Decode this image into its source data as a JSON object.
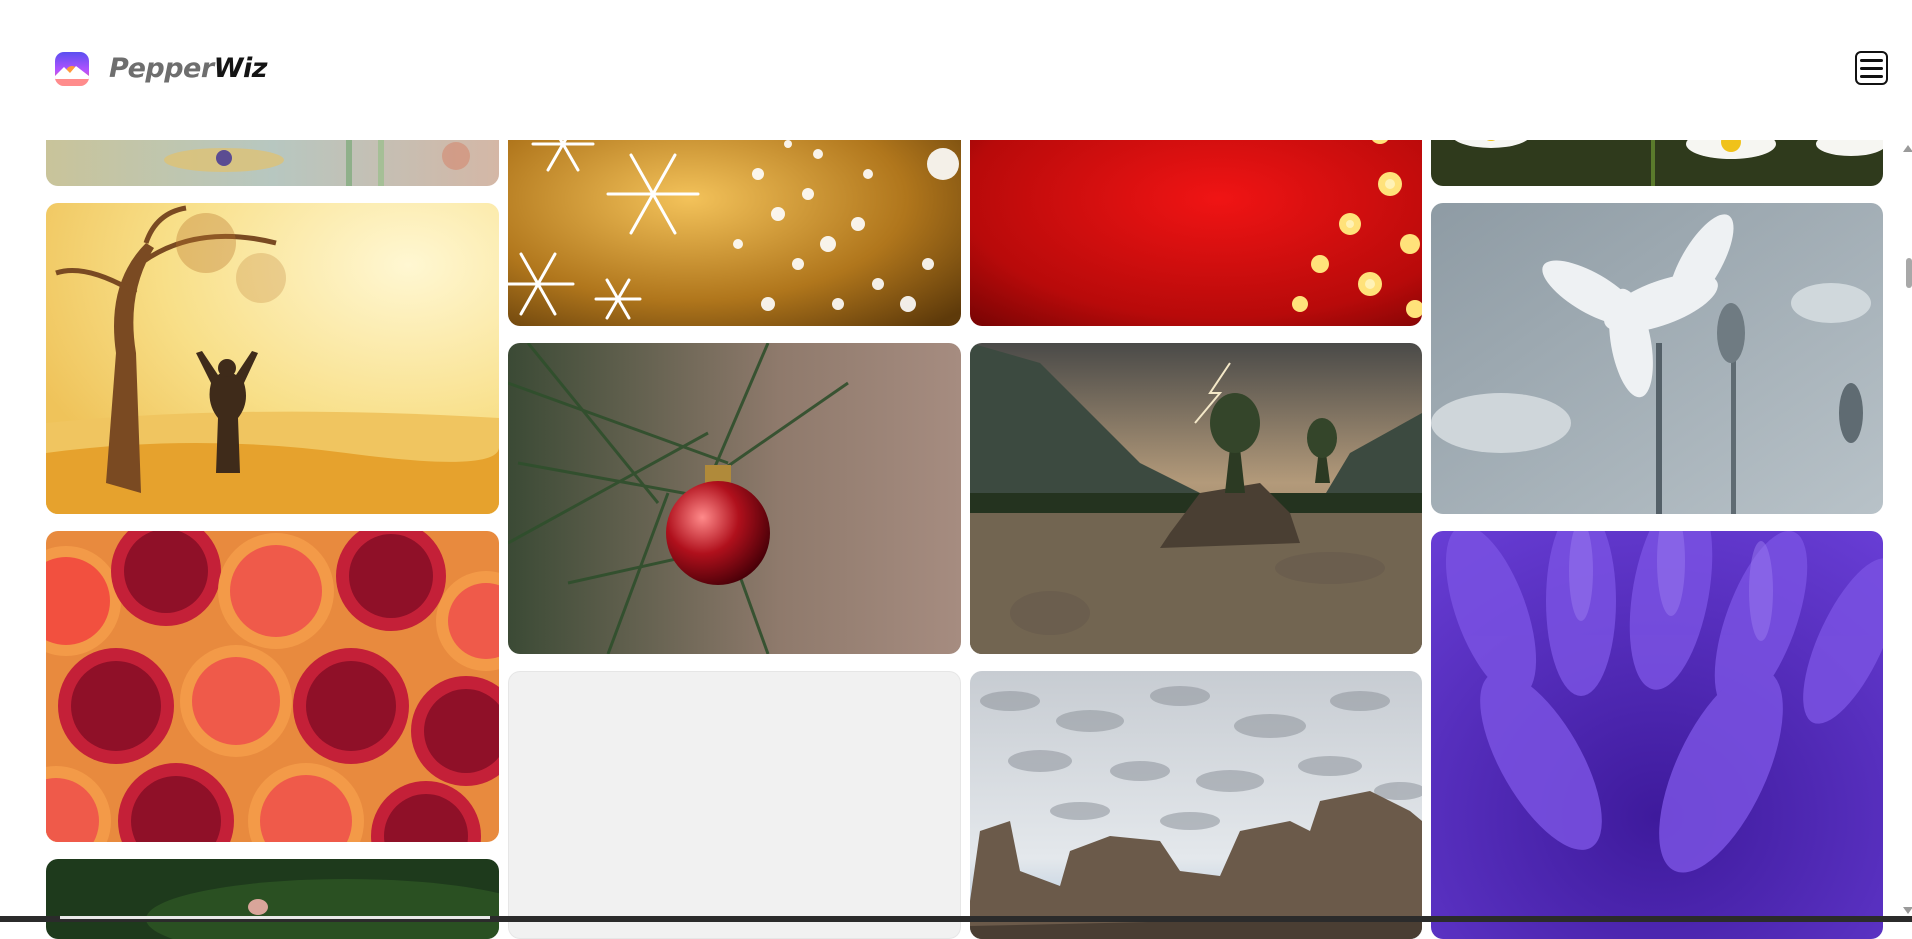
{
  "app": {
    "brand_part1": "Pepper",
    "brand_part2": "Wiz",
    "logo_icon": "mountain-logo-icon",
    "menu_icon": "hamburger-menu-icon",
    "colors": {
      "logo_top": "#5a4ff0",
      "logo_mid": "#b452ff",
      "logo_sun": "#ff9a3c",
      "logo_bottom": "#ff5f7a",
      "brand_light": "#6e6e6e",
      "brand_dark": "#141414"
    }
  },
  "gallery": {
    "columns": [
      [
        "meadow-flowers-photo",
        "autumn-tree-woman-illustration",
        "pomegranate-grapefruit-photo",
        "green-leaf-photo"
      ],
      [
        "golden-snowflakes-image",
        "christmas-ornament-pine-photo",
        "loading-placeholder"
      ],
      [
        "red-christmas-lights-image",
        "mountain-lake-storm-photo",
        "cloudy-sky-rocks-photo"
      ],
      [
        "white-daisies-photo",
        "white-flower-macro-photo",
        "purple-petals-macro-photo"
      ]
    ]
  }
}
